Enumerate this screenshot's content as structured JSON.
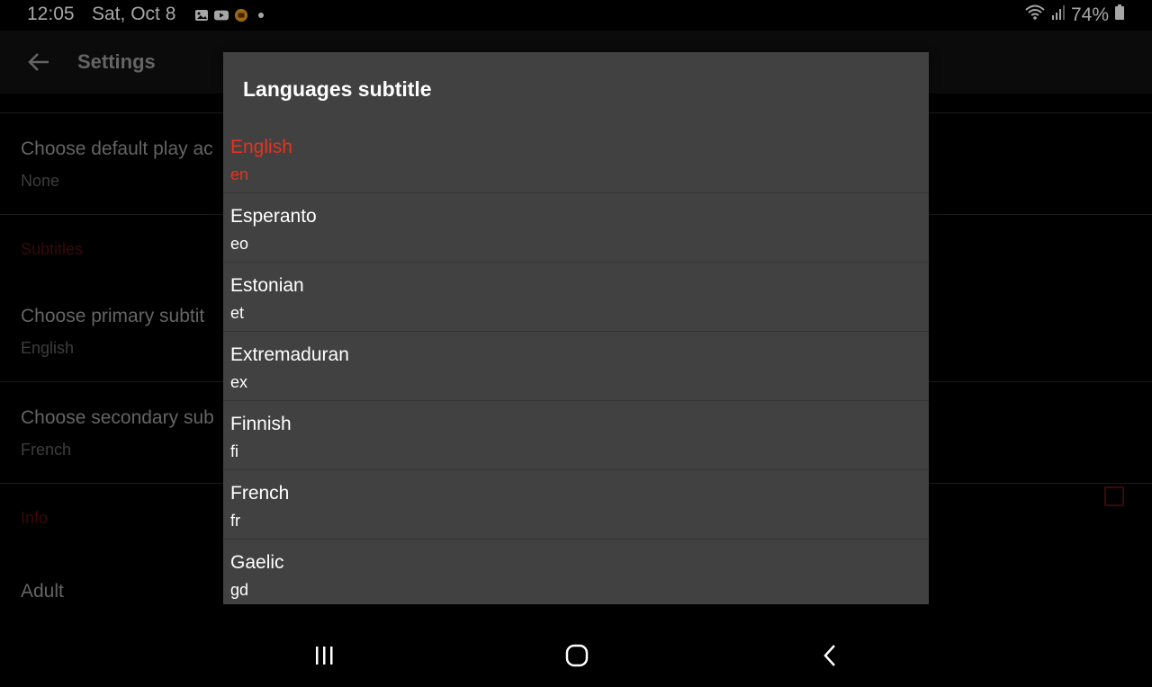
{
  "status_bar": {
    "time": "12:05",
    "date": "Sat, Oct 8",
    "battery": "74%",
    "icons": [
      "gallery-icon",
      "youtube-icon",
      "app-notification-icon",
      "dot-icon",
      "wifi-icon",
      "signal-icon",
      "battery-icon"
    ]
  },
  "appbar": {
    "title": "Settings"
  },
  "settings": {
    "items": [
      {
        "title": "Choose default play ac",
        "value": "None"
      },
      {
        "title": "Choose primary subtit",
        "value": "English"
      },
      {
        "title": "Choose secondary sub",
        "value": "French"
      },
      {
        "title": "Adult"
      }
    ],
    "sections": [
      "Subtitles",
      "Info"
    ]
  },
  "dialog": {
    "title": "Languages subtitle",
    "languages": [
      {
        "name": "English",
        "code": "en",
        "selected": true
      },
      {
        "name": "Esperanto",
        "code": "eo"
      },
      {
        "name": "Estonian",
        "code": "et"
      },
      {
        "name": "Extremaduran",
        "code": "ex"
      },
      {
        "name": "Finnish",
        "code": "fi"
      },
      {
        "name": "French",
        "code": "fr"
      },
      {
        "name": "Gaelic",
        "code": "gd"
      }
    ]
  },
  "colors": {
    "accent": "#e8321e",
    "dialog_bg": "#414141",
    "section_header": "#5a0d0d"
  }
}
